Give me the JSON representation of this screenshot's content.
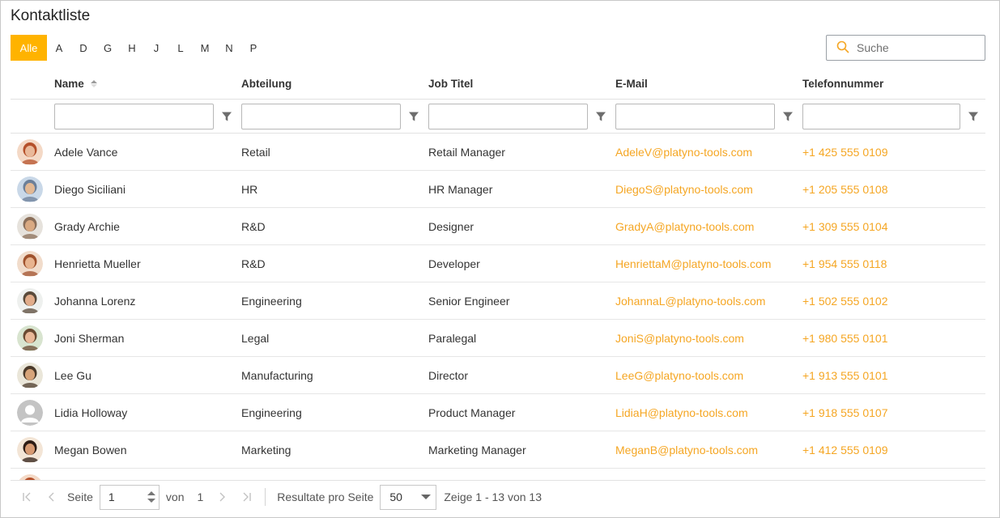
{
  "title": "Kontaktliste",
  "alphabet": {
    "items": [
      "Alle",
      "A",
      "D",
      "G",
      "H",
      "J",
      "L",
      "M",
      "N",
      "P"
    ],
    "active": "Alle"
  },
  "search": {
    "placeholder": "Suche"
  },
  "columns": {
    "name": "Name",
    "department": "Abteilung",
    "job": "Job Titel",
    "email": "E-Mail",
    "phone": "Telefonnummer"
  },
  "sorted_column": "Name",
  "rows": [
    {
      "name": "Adele Vance",
      "department": "Retail",
      "job": "Retail Manager",
      "email": "AdeleV@platyno-tools.com",
      "phone": "+1 425 555 0109",
      "avatar": "photo-woman-red-hair"
    },
    {
      "name": "Diego Siciliani",
      "department": "HR",
      "job": "HR Manager",
      "email": "DiegoS@platyno-tools.com",
      "phone": "+1 205 555 0108",
      "avatar": "photo-man-blue-shirt"
    },
    {
      "name": "Grady Archie",
      "department": "R&D",
      "job": "Designer",
      "email": "GradyA@platyno-tools.com",
      "phone": "+1 309 555 0104",
      "avatar": "photo-man-bald"
    },
    {
      "name": "Henrietta Mueller",
      "department": "R&D",
      "job": "Developer",
      "email": "HenriettaM@platyno-tools.com",
      "phone": "+1 954 555 0118",
      "avatar": "photo-woman-glasses"
    },
    {
      "name": "Johanna Lorenz",
      "department": "Engineering",
      "job": "Senior Engineer",
      "email": "JohannaL@platyno-tools.com",
      "phone": "+1 502 555 0102",
      "avatar": "photo-woman-outdoor"
    },
    {
      "name": "Joni Sherman",
      "department": "Legal",
      "job": "Paralegal",
      "email": "JoniS@platyno-tools.com",
      "phone": "+1 980 555 0101",
      "avatar": "photo-woman-green"
    },
    {
      "name": "Lee Gu",
      "department": "Manufacturing",
      "job": "Director",
      "email": "LeeG@platyno-tools.com",
      "phone": "+1 913 555 0101",
      "avatar": "photo-man-light"
    },
    {
      "name": "Lidia Holloway",
      "department": "Engineering",
      "job": "Product Manager",
      "email": "LidiaH@platyno-tools.com",
      "phone": "+1 918 555 0107",
      "avatar": "placeholder-person-icon"
    },
    {
      "name": "Megan Bowen",
      "department": "Marketing",
      "job": "Marketing Manager",
      "email": "MeganB@platyno-tools.com",
      "phone": "+1 412 555 0109",
      "avatar": "photo-woman-dark-hair"
    }
  ],
  "pager": {
    "page_label": "Seite",
    "page_value": "1",
    "of_label": "von",
    "total_pages": "1",
    "per_page_label": "Resultate pro Seite",
    "per_page_value": "50",
    "summary": "Zeige 1 - 13 von 13"
  },
  "colors": {
    "accent": "#ffb300",
    "link": "#f5a623",
    "border": "#e2e2e2"
  }
}
